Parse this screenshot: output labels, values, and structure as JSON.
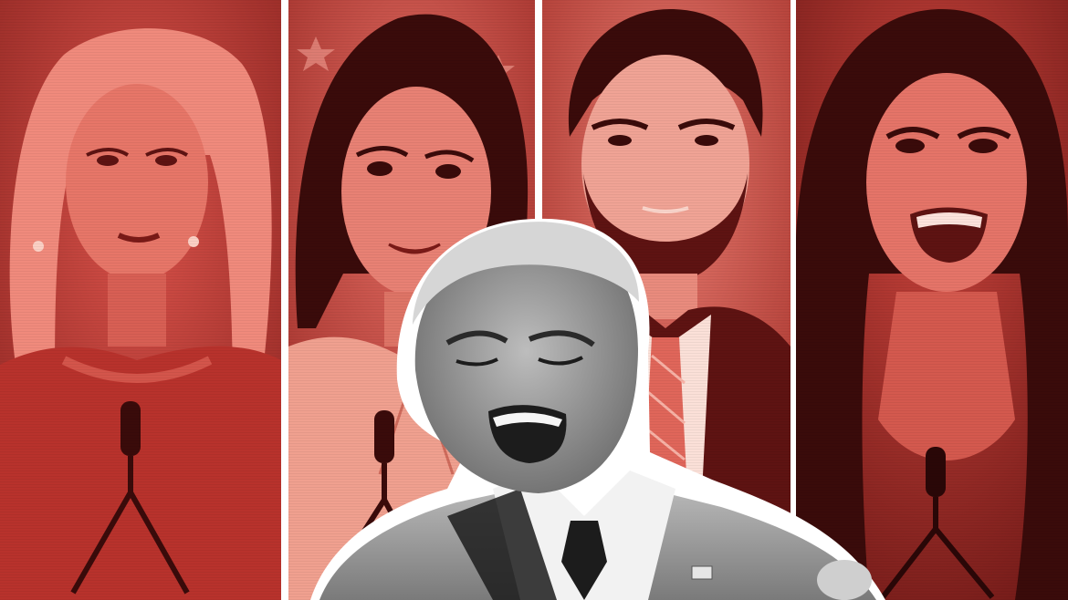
{
  "collage": {
    "panels": [
      {
        "subject": "blonde-woman-speaking"
      },
      {
        "subject": "dark-haired-woman-speaking"
      },
      {
        "subject": "bearded-man-speaking"
      },
      {
        "subject": "laughing-woman-speaking"
      }
    ],
    "center_subject": "shouting-man-in-suit"
  },
  "colors": {
    "panel_red": "#c8403a",
    "panel_dark_red": "#5e1312",
    "panel_light_red": "#f08a7c",
    "divider": "#ffffff",
    "center_gray": "#9a9a9a",
    "center_dark": "#1c1c1c"
  },
  "icons": {
    "microphone": "microphone-icon",
    "flag_pin": "flag-pin-icon"
  }
}
